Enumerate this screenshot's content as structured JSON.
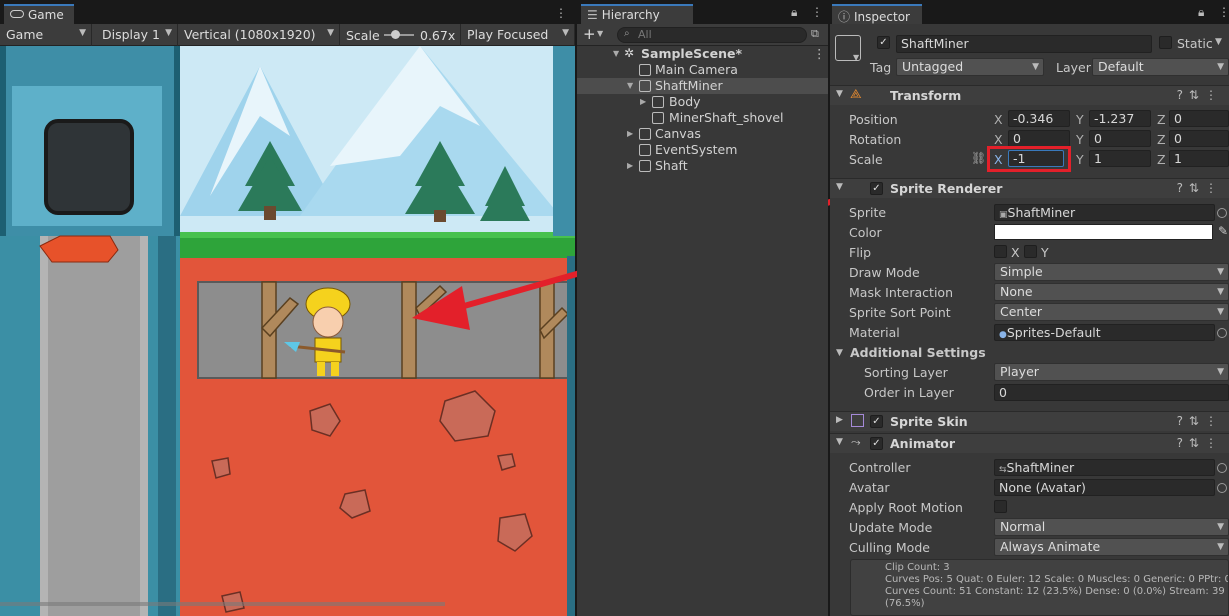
{
  "game": {
    "tab_label": "Game",
    "mode": "Game",
    "display": "Display 1",
    "resolution": "Vertical (1080x1920)",
    "scale_label": "Scale",
    "scale_value": "0.67x",
    "play_mode": "Play Focused"
  },
  "hierarchy": {
    "tab_label": "Hierarchy",
    "search_placeholder": "All",
    "items": [
      {
        "label": "SampleScene*"
      },
      {
        "label": "Main Camera"
      },
      {
        "label": "ShaftMiner"
      },
      {
        "label": "Body"
      },
      {
        "label": "MinerShaft_shovel"
      },
      {
        "label": "Canvas"
      },
      {
        "label": "EventSystem"
      },
      {
        "label": "Shaft"
      }
    ]
  },
  "inspector": {
    "tab_label": "Inspector",
    "object_name": "ShaftMiner",
    "static_label": "Static",
    "tag_label": "Tag",
    "tag_value": "Untagged",
    "layer_label": "Layer",
    "layer_value": "Default",
    "transform": {
      "title": "Transform",
      "position_label": "Position",
      "rotation_label": "Rotation",
      "scale_label": "Scale",
      "position": {
        "x": "-0.346",
        "y": "-1.237",
        "z": "0"
      },
      "rotation": {
        "x": "0",
        "y": "0",
        "z": "0"
      },
      "scale": {
        "x": "-1",
        "y": "1",
        "z": "1"
      }
    },
    "sprite_renderer": {
      "title": "Sprite Renderer",
      "sprite_label": "Sprite",
      "sprite_value": "ShaftMiner",
      "color_label": "Color",
      "color_value": "#ffffff",
      "flip_label": "Flip",
      "flip_x": "X",
      "flip_y": "Y",
      "draw_mode_label": "Draw Mode",
      "draw_mode_value": "Simple",
      "mask_label": "Mask Interaction",
      "mask_value": "None",
      "sort_point_label": "Sprite Sort Point",
      "sort_point_value": "Center",
      "material_label": "Material",
      "material_value": "Sprites-Default",
      "additional_label": "Additional Settings",
      "sorting_layer_label": "Sorting Layer",
      "sorting_layer_value": "Player",
      "order_label": "Order in Layer",
      "order_value": "0"
    },
    "sprite_skin": {
      "title": "Sprite Skin"
    },
    "animator": {
      "title": "Animator",
      "controller_label": "Controller",
      "controller_value": "ShaftMiner",
      "avatar_label": "Avatar",
      "avatar_value": "None (Avatar)",
      "root_motion_label": "Apply Root Motion",
      "update_mode_label": "Update Mode",
      "update_mode_value": "Normal",
      "culling_mode_label": "Culling Mode",
      "culling_mode_value": "Always Animate",
      "info_line1": "Clip Count: 3",
      "info_line2": "Curves Pos: 5 Quat: 0 Euler: 12 Scale: 0 Muscles: 0 Generic: 0 PPtr: 0",
      "info_line3": "Curves Count: 51 Constant: 12 (23.5%) Dense: 0 (0.0%) Stream: 39",
      "info_line4": "(76.5%)"
    }
  },
  "colors": {
    "accent": "#3a79bb",
    "highlight": "#e3202a",
    "sky": "#cde9f5",
    "dirt": "#e2553a",
    "grass": "#2ea43a"
  }
}
